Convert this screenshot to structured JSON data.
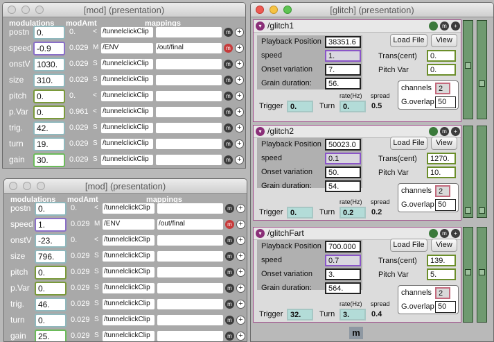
{
  "mod1": {
    "title": "[mod] (presentation)",
    "headers": {
      "modulations": "modulations",
      "modamt": "modAmt",
      "mappings": "mappings"
    },
    "rows": [
      {
        "label": "postn",
        "value": "0.",
        "amt": "0.",
        "type": "<",
        "map1": "/tunnelclickClip",
        "map2": "",
        "m_red": false
      },
      {
        "label": "speed",
        "value": "-0.9",
        "amt": "0.029",
        "type": "M",
        "map1": "/ENV",
        "map2": "/out/final",
        "m_red": true
      },
      {
        "label": "onstV",
        "value": "1030.",
        "amt": "0.029",
        "type": "S",
        "map1": "/tunnelclickClip",
        "map2": "",
        "m_red": false
      },
      {
        "label": "size",
        "value": "310.",
        "amt": "0.029",
        "type": "S",
        "map1": "/tunnelclickClip",
        "map2": "",
        "m_red": false
      },
      {
        "label": "pitch",
        "value": "0.",
        "amt": "0.",
        "type": "<",
        "map1": "/tunnelclickClip",
        "map2": "",
        "m_red": false
      },
      {
        "label": "p.Var",
        "value": "0.",
        "amt": "0.961",
        "type": "<",
        "map1": "/tunnelclickClip",
        "map2": "",
        "m_red": false
      },
      {
        "label": "trig.",
        "value": "42.",
        "amt": "0.029",
        "type": "S",
        "map1": "/tunnelclickClip",
        "map2": "",
        "m_red": false
      },
      {
        "label": "turn",
        "value": "19.",
        "amt": "0.029",
        "type": "S",
        "map1": "/tunnelclickClip",
        "map2": "",
        "m_red": false
      },
      {
        "label": "gain",
        "value": "30.",
        "amt": "0.029",
        "type": "S",
        "map1": "/tunnelclickClip",
        "map2": "",
        "m_red": false
      }
    ]
  },
  "mod2": {
    "title": "[mod] (presentation)",
    "headers": {
      "modulations": "modulations",
      "modamt": "modAmt",
      "mappings": "mappings"
    },
    "rows": [
      {
        "label": "postn",
        "value": "0.",
        "amt": "0.",
        "type": "<",
        "map1": "/tunnelclickClip",
        "map2": "",
        "m_red": false
      },
      {
        "label": "speed",
        "value": "1.",
        "amt": "0.029",
        "type": "M",
        "map1": "/ENV",
        "map2": "/out/final",
        "m_red": true
      },
      {
        "label": "onstV",
        "value": "-23.",
        "amt": "0.",
        "type": "<",
        "map1": "/tunnelclickClip",
        "map2": "",
        "m_red": false
      },
      {
        "label": "size",
        "value": "796.",
        "amt": "0.029",
        "type": "S",
        "map1": "/tunnelclickClip",
        "map2": "",
        "m_red": false
      },
      {
        "label": "pitch",
        "value": "0.",
        "amt": "0.029",
        "type": "S",
        "map1": "/tunnelclickClip",
        "map2": "",
        "m_red": false
      },
      {
        "label": "p.Var",
        "value": "0.",
        "amt": "0.029",
        "type": "S",
        "map1": "/tunnelclickClip",
        "map2": "",
        "m_red": false
      },
      {
        "label": "trig.",
        "value": "46.",
        "amt": "0.029",
        "type": "S",
        "map1": "/tunnelclickClip",
        "map2": "",
        "m_red": false
      },
      {
        "label": "turn",
        "value": "0.",
        "amt": "0.029",
        "type": "S",
        "map1": "/tunnelclickClip",
        "map2": "",
        "m_red": false
      },
      {
        "label": "gain",
        "value": "25.",
        "amt": "0.029",
        "type": "S",
        "map1": "/tunnelclickClip",
        "map2": "",
        "m_red": false
      }
    ]
  },
  "glitch": {
    "title": "[glitch] (presentation)",
    "labels": {
      "playback": "Playback Position",
      "speed": "speed",
      "onset": "Onset variation",
      "grain": "Grain duration:",
      "trans": "Trans(cent)",
      "pitchvar": "Pitch Var",
      "channels": "channels",
      "goverlap": "G.overlap",
      "trigger": "Trigger",
      "turn": "Turn",
      "rate": "rate(Hz)",
      "spread": "spread",
      "load": "Load File",
      "view": "View"
    },
    "panels": [
      {
        "name": "/glitch1",
        "playback": "38351.6",
        "speed": "1.",
        "onset": "7.",
        "grain": "56.",
        "trans": "0.",
        "pitchvar": "0.",
        "channels": "2",
        "goverlap": "50",
        "trigger": "0.",
        "rate": "0.",
        "spread": "0.5"
      },
      {
        "name": "/glitch2",
        "playback": "50023.0",
        "speed": "0.1",
        "onset": "50.",
        "grain": "54.",
        "trans": "1270.",
        "pitchvar": "10.",
        "channels": "2",
        "goverlap": "50",
        "trigger": "0.",
        "rate": "0.2",
        "spread": "0.2"
      },
      {
        "name": "/glitchFart",
        "playback": "700.000",
        "speed": "0.7",
        "onset": "3.",
        "grain": "564.",
        "trans": "139.",
        "pitchvar": "5.",
        "channels": "2",
        "goverlap": "50",
        "trigger": "32.",
        "rate": "3.",
        "spread": "0.4"
      }
    ],
    "bottom_m": "m"
  },
  "icons": {
    "m": "m",
    "plus": "+",
    "dropdown": "▾"
  },
  "colors": {
    "panel_border": "#a04d8b",
    "purple_field": "#8a55c8",
    "green_field": "#6b8e2a",
    "cyan_field": "#b3dcd8"
  }
}
